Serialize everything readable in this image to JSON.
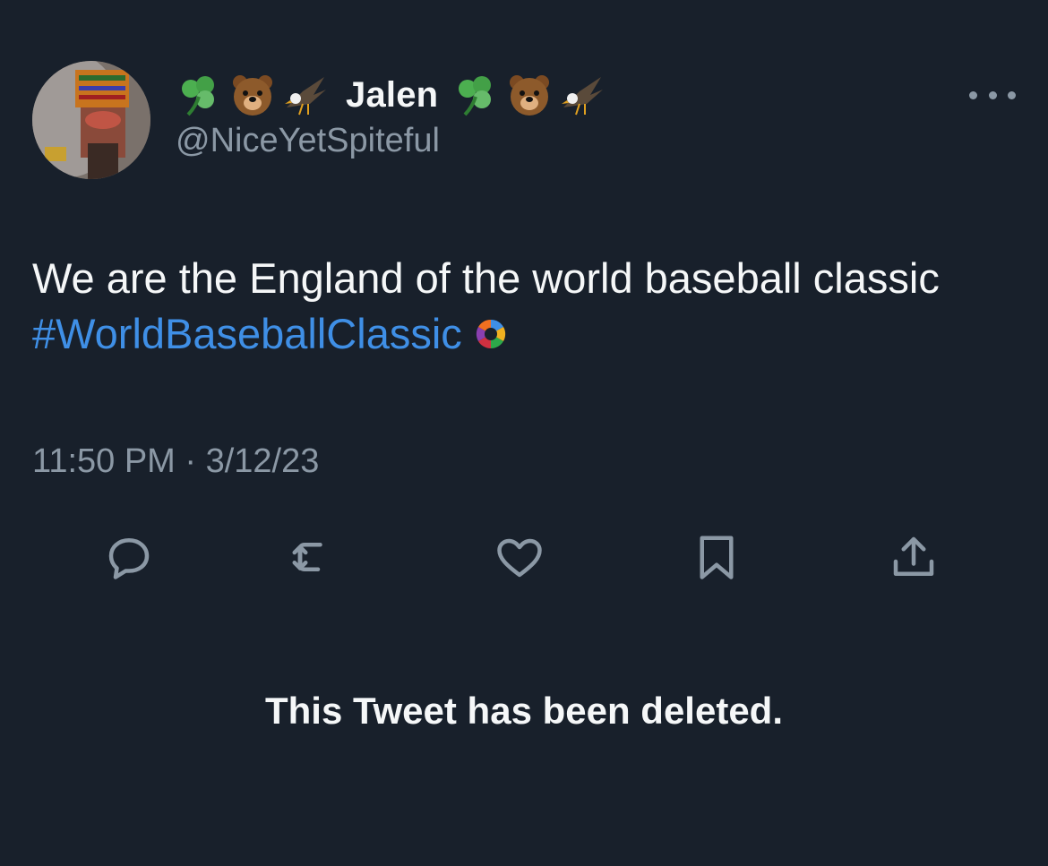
{
  "tweet": {
    "display_name": "Jalen",
    "handle": "@NiceYetSpiteful",
    "text": "We are the England of the world baseball classic",
    "hashtag": "#WorldBaseballClassic",
    "timestamp": "11:50 PM · 3/12/23"
  },
  "name_emojis": [
    "shamrock-icon",
    "bear-icon",
    "eagle-icon",
    "shamrock-icon",
    "bear-icon",
    "eagle-icon"
  ],
  "actions": [
    "reply-icon",
    "retweet-icon",
    "like-icon",
    "bookmark-icon",
    "share-icon"
  ],
  "notice": "This Tweet has been deleted.",
  "colors": {
    "background": "#18202b",
    "text": "#f5f7f8",
    "secondary": "#8b98a5",
    "link": "#3f8fe6"
  }
}
